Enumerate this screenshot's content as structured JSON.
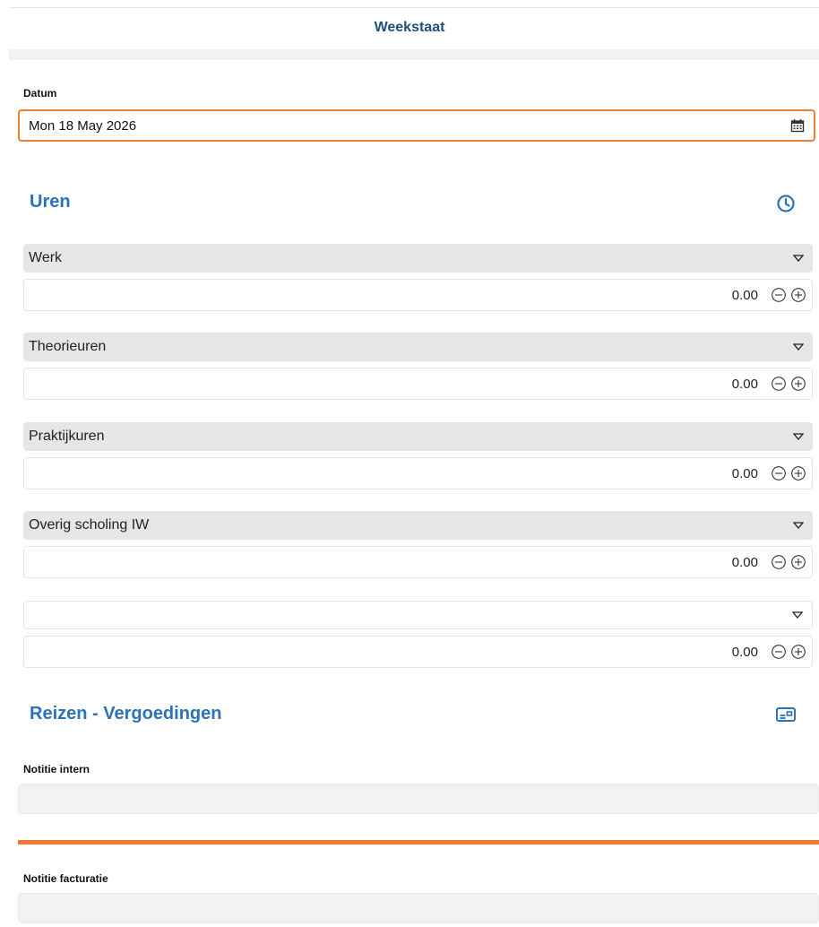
{
  "header": {
    "title": "Weekstaat"
  },
  "datum": {
    "label": "Datum",
    "value": "Mon 18 May 2026",
    "icon": "calendar-icon"
  },
  "uren": {
    "title": "Uren",
    "icon": "clock-icon",
    "rows": [
      {
        "category": "Werk",
        "hours": "0.00"
      },
      {
        "category": "Theorieuren",
        "hours": "0.00"
      },
      {
        "category": "Praktijkuren",
        "hours": "0.00"
      },
      {
        "category": "Overig scholing IW",
        "hours": "0.00"
      },
      {
        "category": "",
        "hours": "0.00"
      }
    ]
  },
  "reizen": {
    "title": "Reizen - Vergoedingen",
    "icon": "id-card-icon"
  },
  "notitie_intern": {
    "label": "Notitie intern",
    "value": ""
  },
  "notitie_facturatie": {
    "label": "Notitie facturatie",
    "value": ""
  },
  "colors": {
    "accent": "#ee7a2f",
    "title_blue": "#2a73b8",
    "header_blue": "#1f4f7a"
  }
}
